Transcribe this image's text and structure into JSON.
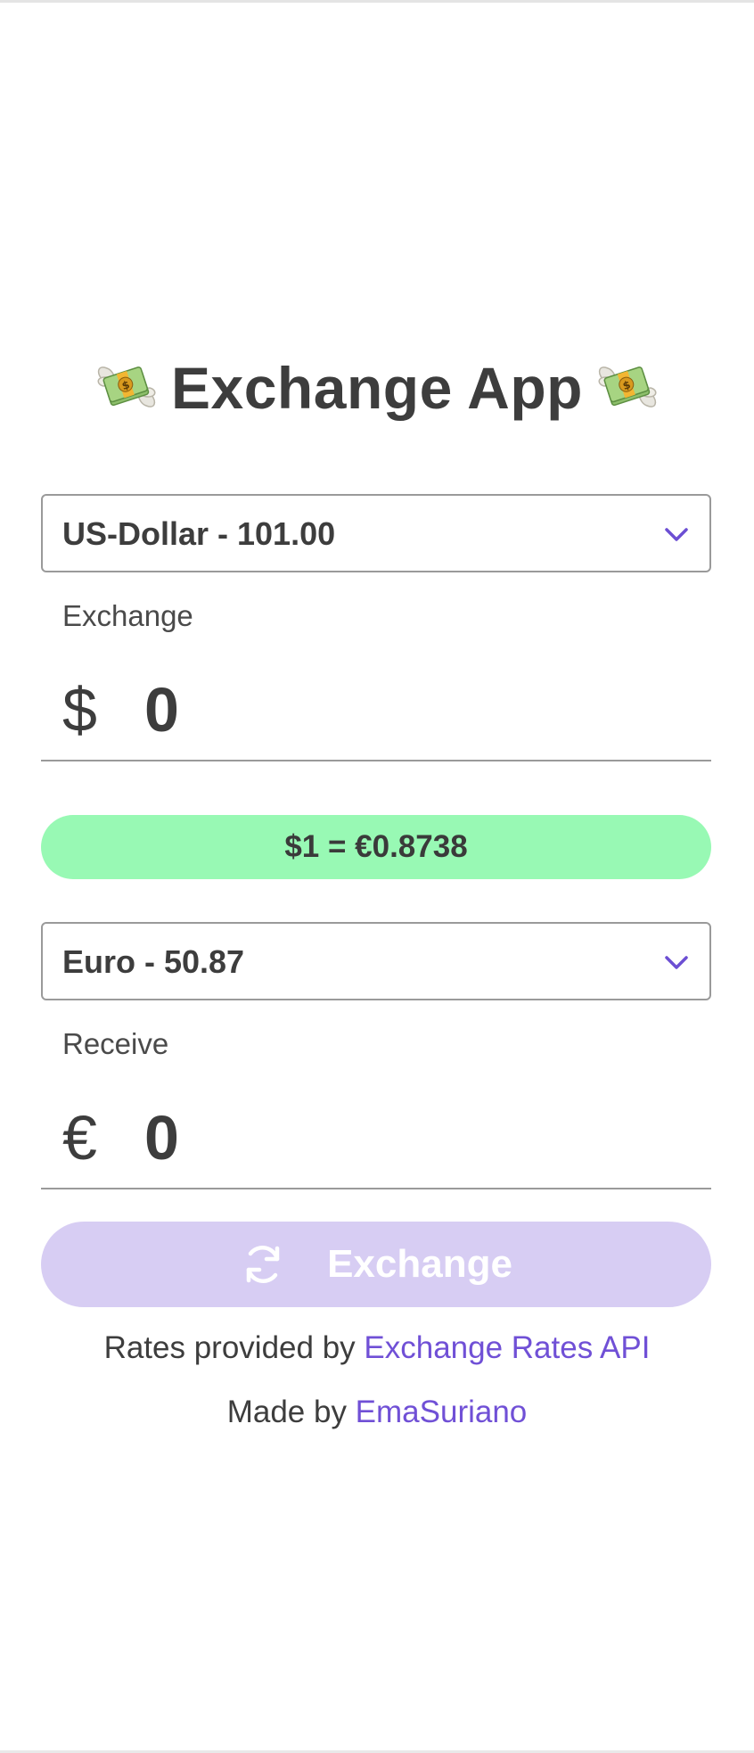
{
  "title": {
    "text": "Exchange App",
    "left_icon": "money-with-wings-icon",
    "right_icon": "money-with-wings-icon"
  },
  "from": {
    "select_value": "US-Dollar - 101.00",
    "label": "Exchange",
    "symbol": "$",
    "amount": "0"
  },
  "rate": {
    "text": "$1 = €0.8738"
  },
  "to": {
    "select_value": "Euro - 50.87",
    "label": "Receive",
    "symbol": "€",
    "amount": "0"
  },
  "exchange_button": {
    "label": "Exchange",
    "icon": "refresh-icon"
  },
  "footer": {
    "rates_prefix": "Rates provided by ",
    "rates_link": "Exchange Rates API",
    "made_prefix": "Made by ",
    "made_link": "EmaSuriano"
  },
  "colors": {
    "accent": "#7050d6",
    "rate_pill": "#98f9b4",
    "button_disabled": "#d7cdf3",
    "text": "#3d3d3d"
  }
}
